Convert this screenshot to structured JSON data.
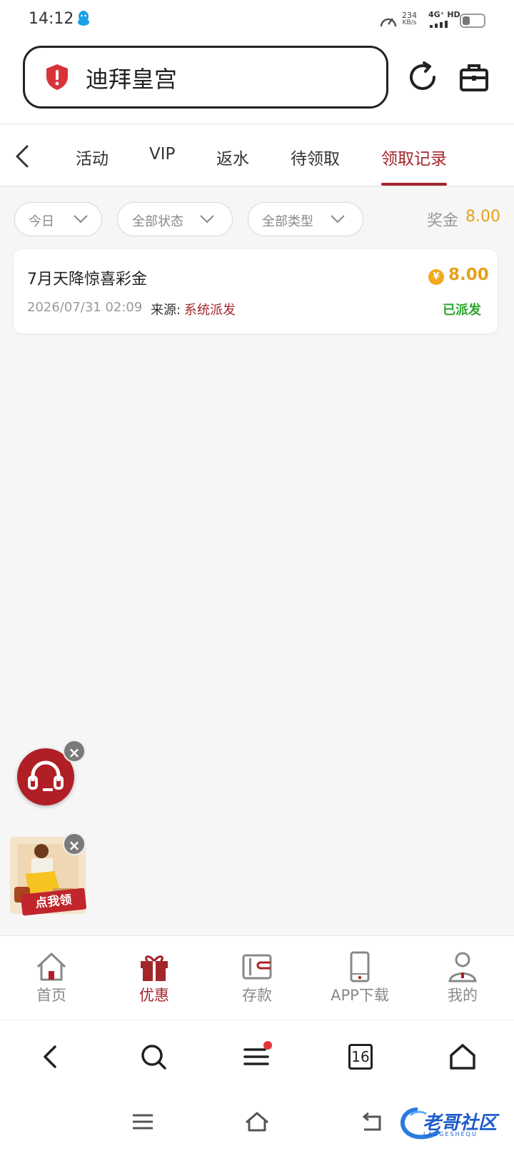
{
  "status_bar": {
    "time": "14:12",
    "speed_value": "234",
    "speed_unit": "KB/s",
    "network": "4G⁺ HD"
  },
  "header": {
    "url_text": "迪拜皇宫"
  },
  "tabs": [
    {
      "label": "活动"
    },
    {
      "label": "VIP"
    },
    {
      "label": "返水"
    },
    {
      "label": "待领取"
    },
    {
      "label": "领取记录",
      "active": true
    }
  ],
  "filters": {
    "date": "今日",
    "status": "全部状态",
    "type": "全部类型",
    "bonus_label": "奖金",
    "bonus_value": "8.00"
  },
  "records": [
    {
      "title": "7月天降惊喜彩金",
      "amount": "8.00",
      "coin_symbol": "¥",
      "datetime": "2026/07/31 02:09",
      "source_label": "来源:",
      "source_value": "系统派发",
      "status": "已派发"
    }
  ],
  "floating": {
    "promo_label": "点我领",
    "close_symbol": "×"
  },
  "app_nav": [
    {
      "label": "首页",
      "icon": "home-icon"
    },
    {
      "label": "优惠",
      "icon": "gift-icon",
      "active": true
    },
    {
      "label": "存款",
      "icon": "wallet-icon"
    },
    {
      "label": "APP下载",
      "icon": "phone-icon"
    },
    {
      "label": "我的",
      "icon": "user-icon"
    }
  ],
  "browser_bar": {
    "tab_count": "16"
  },
  "watermark": {
    "text": "老哥社区",
    "sub": "LAOGESHEQU"
  },
  "colors": {
    "accent": "#a3262b",
    "gold": "#e6a11b",
    "success": "#2aa52a"
  }
}
